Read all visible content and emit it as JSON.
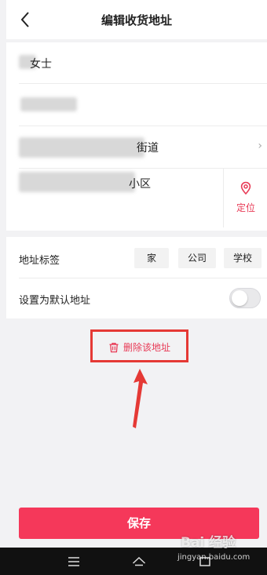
{
  "header": {
    "title": "编辑收货地址"
  },
  "form": {
    "name_suffix": "女士",
    "street_suffix": "街道",
    "community_suffix": "小区"
  },
  "locate": {
    "label": "定位",
    "icon": "location-pin-icon"
  },
  "tags": {
    "label": "地址标签",
    "options": [
      "家",
      "公司",
      "学校"
    ]
  },
  "default_setting": {
    "label": "设置为默认地址",
    "enabled": false
  },
  "delete": {
    "label": "删除该地址"
  },
  "save": {
    "label": "保存"
  },
  "watermark": {
    "brand": "Bai 经验",
    "url": "jingyan.baidu.com"
  },
  "colors": {
    "accent": "#f5385a",
    "highlight_box": "#e53935",
    "toggle_off": "#e9e9eb"
  }
}
